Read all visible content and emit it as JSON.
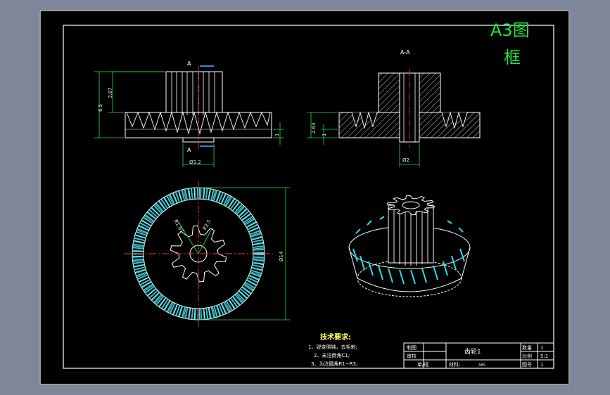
{
  "frame": {
    "format_label_line1": "A3图",
    "format_label_line2": "框",
    "format_color": "#1ee53c"
  },
  "views": {
    "front": {
      "section_marker_top": "A",
      "section_marker_bottom": "A",
      "dim_height_total": "6.5",
      "dim_height_hub": "3.87",
      "dim_base": "1",
      "dim_diameter": "Ø3.2"
    },
    "section": {
      "title": "A-A",
      "dim_height": "2.63",
      "dim_step": "1",
      "dim_bore": "Ø2"
    },
    "top": {
      "dim_outer_diameter": "Ø14",
      "dim_r1": "R1.87",
      "dim_r2": "R2.5"
    }
  },
  "requirements": {
    "title": "技术要求:",
    "items": [
      "1、锐变倒钝，去毛刺;",
      "2、未注倒角C1;",
      "3、为注圆角R1~R3;"
    ]
  },
  "title_block": {
    "drawn_label": "制图",
    "checked_label": "审核",
    "unit_label": "单/班",
    "part_name": "齿轮1",
    "material_label": "材料:",
    "material_value": "ABS",
    "qty_label": "数量",
    "qty_value": "1",
    "scale_label": "比例",
    "scale_value": "5:1",
    "drawing_no_label": "图号",
    "drawing_no_value": "1"
  },
  "colors": {
    "line": "#ffffff",
    "dimension": "#22dd44",
    "centerline": "#ff3030",
    "cyan": "#22e0ee",
    "title_text": "#ffff66"
  }
}
